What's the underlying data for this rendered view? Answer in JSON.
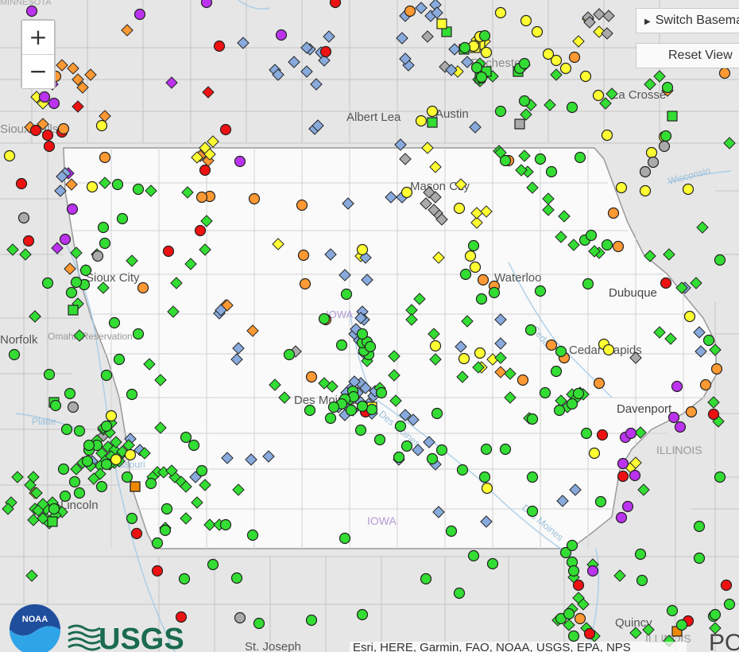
{
  "map": {
    "labels": [
      {
        "text": "Albert Lea",
        "kind": "city"
      },
      {
        "text": "Austin",
        "kind": "city"
      },
      {
        "text": "Rochester",
        "kind": "city"
      },
      {
        "text": "La Crosse",
        "kind": "city"
      },
      {
        "text": "Mason City",
        "kind": "city"
      },
      {
        "text": "Sioux City",
        "kind": "city"
      },
      {
        "text": "Waterloo",
        "kind": "city"
      },
      {
        "text": "Dubuque",
        "kind": "city"
      },
      {
        "text": "Cedar Rapids",
        "kind": "city"
      },
      {
        "text": "Des Moines",
        "kind": "city"
      },
      {
        "text": "Davenport",
        "kind": "city"
      },
      {
        "text": "Lincoln",
        "kind": "city"
      },
      {
        "text": "Quincy",
        "kind": "city"
      },
      {
        "text": "St. Joseph",
        "kind": "city"
      },
      {
        "text": "Omaha Reservation",
        "kind": "area"
      },
      {
        "text": "Sioux Falls",
        "kind": "city"
      },
      {
        "text": "Norfolk",
        "kind": "city"
      },
      {
        "text": "IOWA",
        "kind": "state"
      },
      {
        "text": "IOWA",
        "kind": "state"
      },
      {
        "text": "ILLINOIS",
        "kind": "state"
      },
      {
        "text": "ILLINOIS",
        "kind": "state"
      },
      {
        "text": "MINNESOTA",
        "kind": "state"
      },
      {
        "text": "Wisconsin",
        "kind": "river"
      },
      {
        "text": "Cedar",
        "kind": "river"
      },
      {
        "text": "Des Moines",
        "kind": "river"
      },
      {
        "text": "Des Moines",
        "kind": "river"
      },
      {
        "text": "Platte",
        "kind": "river"
      },
      {
        "text": "Missouri",
        "kind": "river"
      }
    ]
  },
  "status_colors": {
    "green": "#33dd33",
    "yellow": "#ffff33",
    "orange": "#ff9933",
    "red": "#ee1111",
    "purple": "#bb33ee",
    "gray": "#aaaaaa",
    "blue": "#88aadd",
    "darkgray": "#777777",
    "darkorange": "#ee8800"
  },
  "controls": {
    "zoom_in": "+",
    "zoom_out": "−",
    "switch_basemap": "Switch Basemap",
    "reset_view": "Reset View"
  },
  "logos": {
    "noaa": "NOAA",
    "usgs": "USGS"
  },
  "attribution": "Esri, HERE, Garmin, FAO, NOAA, USGS, EPA, NPS",
  "powered_by": "POWERED BY esri"
}
